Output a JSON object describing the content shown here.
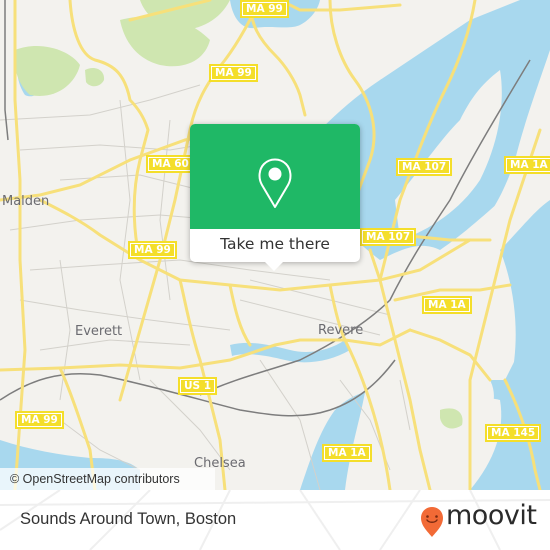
{
  "map": {
    "attribution": "© OpenStreetMap contributors",
    "colors": {
      "land": "#f3f2ee",
      "water": "#a8d8ee",
      "park": "#cfe6b0",
      "major_road": "#f7e07a",
      "minor_road": "#d0cec8",
      "rail": "#7d7d7d",
      "shield_bg": "#f4de2a"
    },
    "places": [
      {
        "name": "Malden"
      },
      {
        "name": "Everett"
      },
      {
        "name": "Revere"
      },
      {
        "name": "Chelsea"
      }
    ],
    "road_shields": [
      {
        "label": "MA 99"
      },
      {
        "label": "MA 99"
      },
      {
        "label": "MA 60"
      },
      {
        "label": "MA 99"
      },
      {
        "label": "MA 107"
      },
      {
        "label": "MA 107"
      },
      {
        "label": "MA 1A"
      },
      {
        "label": "MA 1A"
      },
      {
        "label": "US 1"
      },
      {
        "label": "MA 99"
      },
      {
        "label": "MA 1A"
      },
      {
        "label": "MA 145"
      }
    ]
  },
  "popup": {
    "button_label": "Take me there",
    "accent_color": "#1fb866",
    "icon": "location-pin-icon"
  },
  "footer": {
    "place_name": "Sounds Around Town, Boston",
    "brand": "moovit",
    "brand_color": "#f26a36"
  }
}
